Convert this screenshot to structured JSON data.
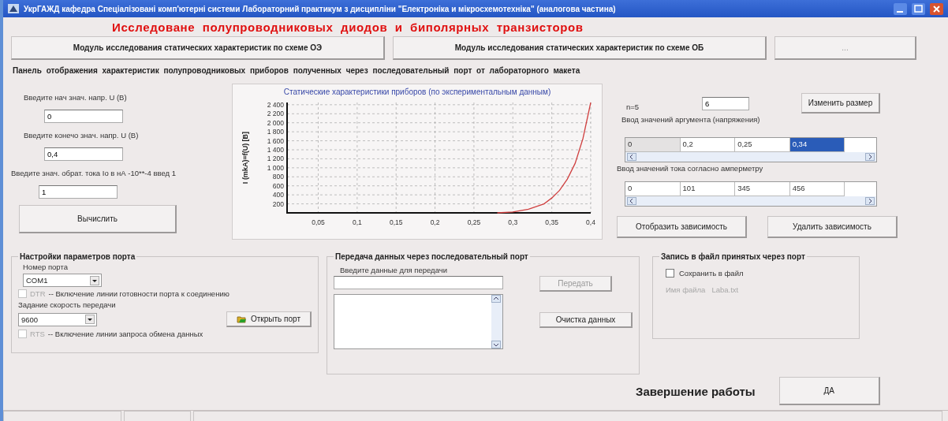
{
  "window": {
    "title": "УкрГАЖД  кафедра  Спеціалізовані комп'ютерні системи  Лабораторний практикум з дисципліни \"Електроніка и мікросхемотехніка\" (аналогова частина)"
  },
  "heading": "Исследоване  полупроводниковых  диодов  и  биполярных  транзисторов",
  "module_buttons": [
    {
      "label": "Модуль исследования статических  характеристик  по схеме ОЭ",
      "disabled": false
    },
    {
      "label": "Модуль исследования статических  характеристик по схеме ОБ",
      "disabled": false
    },
    {
      "label": "...",
      "disabled": true
    }
  ],
  "panel_caption": "Панель  отображения  характеристик  полупроводниковых  приборов  полученных  через  последовательный   порт  от  лабораторного макета",
  "inputs": [
    {
      "label": "Введите  нач знач. напр. U (B)",
      "value": "0"
    },
    {
      "label": "Введите конечо знач. напр. U (B)",
      "value": "0,4"
    },
    {
      "label": "Введите  знач. обрат. тока Io в нА -10**-4 введ 1",
      "value": "1"
    }
  ],
  "calculate_button": "Вычислить",
  "chart": {
    "title": "Статические характеристики приборов (по экспериментальным данным)",
    "chart_data": {
      "type": "line",
      "ylabel": "I (mkA)=f(U) [B]",
      "x": [
        0.28,
        0.3,
        0.32,
        0.34,
        0.35,
        0.36,
        0.37,
        0.38,
        0.39,
        0.4
      ],
      "grid": true,
      "series": [
        {
          "color": "#d04040",
          "values": [
            0,
            20,
            80,
            200,
            330,
            500,
            750,
            1100,
            1650,
            2450
          ]
        }
      ],
      "xlim": [
        0.01,
        0.4
      ],
      "ylim": [
        0,
        2450
      ],
      "xticks": [
        {
          "value": 0.05,
          "label": "0,05"
        },
        {
          "value": 0.1,
          "label": "0,1"
        },
        {
          "value": 0.15,
          "label": "0,15"
        },
        {
          "value": 0.2,
          "label": "0,2"
        },
        {
          "value": 0.25,
          "label": "0,25"
        },
        {
          "value": 0.3,
          "label": "0,3"
        },
        {
          "value": 0.35,
          "label": "0,35"
        },
        {
          "value": 0.4,
          "label": "0,4"
        }
      ],
      "yticks": [
        {
          "value": 200,
          "label": "200"
        },
        {
          "value": 400,
          "label": "400"
        },
        {
          "value": 600,
          "label": "600"
        },
        {
          "value": 800,
          "label": "800"
        },
        {
          "value": 1000,
          "label": "1 000"
        },
        {
          "value": 1200,
          "label": "1 200"
        },
        {
          "value": 1400,
          "label": "1 400"
        },
        {
          "value": 1600,
          "label": "1 600"
        },
        {
          "value": 1800,
          "label": "1 800"
        },
        {
          "value": 2000,
          "label": "2 000"
        },
        {
          "value": 2200,
          "label": "2 200"
        },
        {
          "value": 2400,
          "label": "2 400"
        }
      ]
    }
  },
  "size": {
    "label": "n=5",
    "value": "6",
    "button": "Изменить размер"
  },
  "argument_grid": {
    "label": "Ввод  значений  аргумента (напряжения)",
    "cells": [
      {
        "text": "0",
        "kind": "fixed",
        "selected": false
      },
      {
        "text": "0,2",
        "kind": "cell",
        "selected": false
      },
      {
        "text": "0,25",
        "kind": "cell",
        "selected": false
      },
      {
        "text": "0,34",
        "kind": "cell",
        "selected": true
      }
    ]
  },
  "current_grid": {
    "label": "Ввод  значений  тока  согласно  амперметру",
    "cells": [
      {
        "text": "0",
        "kind": "cell",
        "selected": false
      },
      {
        "text": "101",
        "kind": "cell",
        "selected": false
      },
      {
        "text": "345",
        "kind": "cell",
        "selected": false
      },
      {
        "text": "456",
        "kind": "cell",
        "selected": false
      }
    ]
  },
  "graph_buttons": [
    "Отобразить зависимость",
    "Удалить зависимость"
  ],
  "port_settings": {
    "legend": "Настройки параметров порта",
    "port_label": "Номер порта",
    "port_value": "COM1",
    "dtr": {
      "name": "DTR",
      "text": "--  Включение  линии готовности порта к соединению",
      "checked": false,
      "disabled": true
    },
    "speed_label": "Задание  скорость передачи",
    "speed_value": "9600",
    "open_button": "Открыть порт",
    "rts": {
      "name": "RTS",
      "text": "--  Включение  линии запроса обмена данных",
      "checked": false,
      "disabled": true
    }
  },
  "transfer": {
    "legend": "Передача данных через последовательный порт",
    "input_label": "Введите данные для передачи",
    "send_button": "Передать",
    "send_disabled": true,
    "clear_button": "Очистка данных"
  },
  "file_record": {
    "legend": "Запись в файл принятых через  порт",
    "save": {
      "label": "Сохранить в файл",
      "checked": false
    },
    "file_label": "Имя файла",
    "file_name": "Laba.txt",
    "disabled": true
  },
  "finish": {
    "label": "Завершение работы",
    "button": "ДА"
  }
}
